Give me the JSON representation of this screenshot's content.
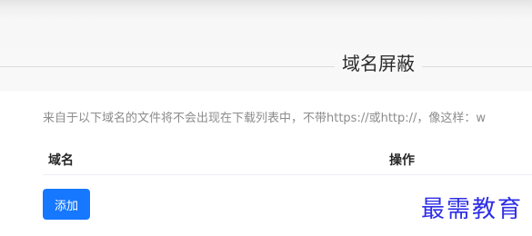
{
  "section": {
    "title": "域名屏蔽",
    "description": "来自于以下域名的文件将不会出现在下载列表中，不带https://或http://，像这样：w"
  },
  "table": {
    "columns": [
      "域名",
      "操作"
    ]
  },
  "actions": {
    "add_label": "添加"
  },
  "watermark": {
    "text": "最需教育"
  },
  "colors": {
    "primary": "#1677ff",
    "watermark": "#2e2ee6"
  }
}
